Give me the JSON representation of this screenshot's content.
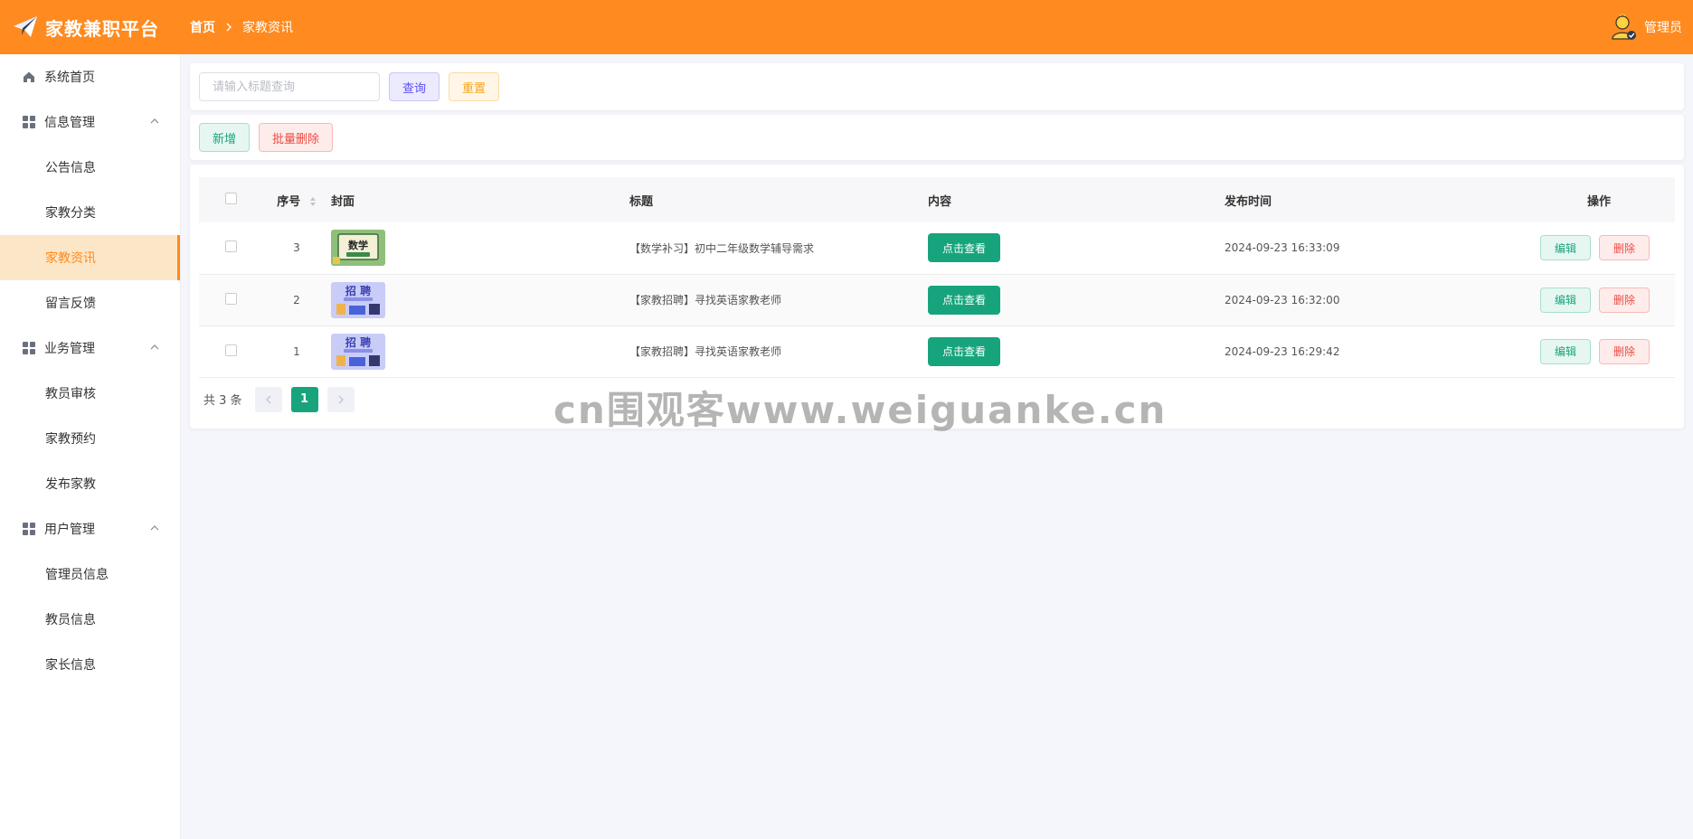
{
  "header": {
    "brand_title": "家教兼职平台",
    "breadcrumb": {
      "home": "首页",
      "current": "家教资讯"
    },
    "user_name": "管理员",
    "bg_color": "#ff8a1f"
  },
  "sidebar": {
    "items": [
      {
        "label": "系统首页",
        "icon": "home-icon"
      },
      {
        "label": "信息管理",
        "icon": "grid-icon",
        "expanded": true,
        "children": [
          "公告信息",
          "家教分类",
          "家教资讯",
          "留言反馈"
        ]
      },
      {
        "label": "业务管理",
        "icon": "grid-icon",
        "expanded": true,
        "children": [
          "教员审核",
          "家教预约",
          "发布家教"
        ]
      },
      {
        "label": "用户管理",
        "icon": "grid-icon",
        "expanded": true,
        "children": [
          "管理员信息",
          "教员信息",
          "家长信息"
        ]
      }
    ],
    "active": "家教资讯"
  },
  "search": {
    "placeholder": "请输入标题查询",
    "value": "",
    "query_label": "查询",
    "reset_label": "重置"
  },
  "actions": {
    "add_label": "新增",
    "batch_delete_label": "批量删除"
  },
  "table": {
    "headers": {
      "index": "序号",
      "cover": "封面",
      "title": "标题",
      "content": "内容",
      "time": "发布时间",
      "op": "操作"
    },
    "rows": [
      {
        "index": "3",
        "cover": "math-cover",
        "cover_text": "数学",
        "title": "【数学补习】初中二年级数学辅导需求",
        "content_btn": "点击查看",
        "time": "2024-09-23 16:33:09",
        "edit": "编辑",
        "delete": "删除"
      },
      {
        "index": "2",
        "cover": "recruit-cover",
        "cover_text": "招 聘",
        "title": "【家教招聘】寻找英语家教老师",
        "content_btn": "点击查看",
        "time": "2024-09-23 16:32:00",
        "edit": "编辑",
        "delete": "删除"
      },
      {
        "index": "1",
        "cover": "recruit-cover",
        "cover_text": "招 聘",
        "title": "【家教招聘】寻找英语家教老师",
        "content_btn": "点击查看",
        "time": "2024-09-23 16:29:42",
        "edit": "编辑",
        "delete": "删除"
      }
    ]
  },
  "pagination": {
    "total_text": "共 3 条",
    "current_page": "1"
  },
  "watermark": "cn围观客www.weiguanke.cn",
  "colors": {
    "accent": "#ff8a1f",
    "primary": "#17a47c",
    "danger": "#ef4a42"
  }
}
